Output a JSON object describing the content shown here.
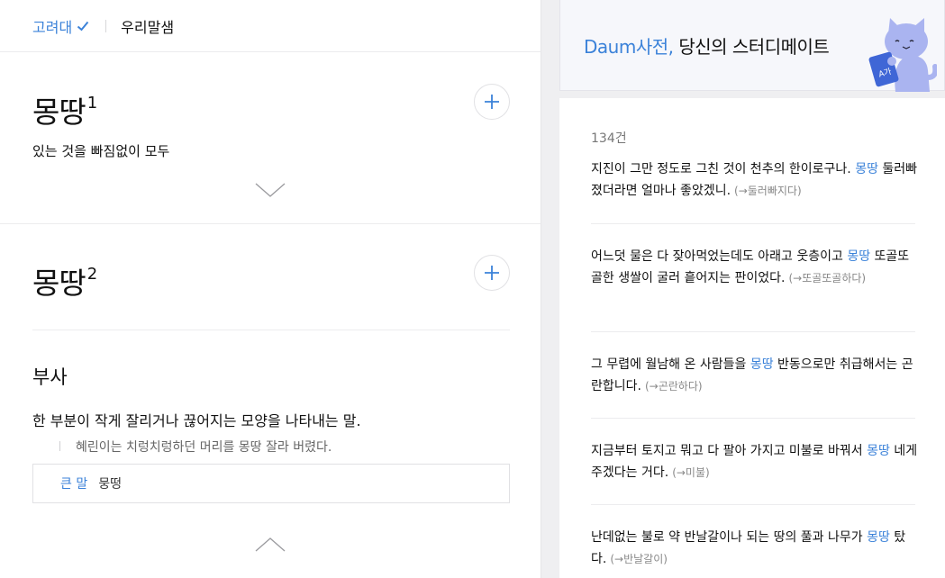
{
  "tabs": {
    "active": "고려대",
    "second": "우리말샘"
  },
  "entries": [
    {
      "word": "몽땅",
      "sup": "1",
      "meaning": "있는 것을 빠짐없이 모두"
    },
    {
      "word": "몽땅",
      "sup": "2",
      "pos": "부사",
      "meaning": "한 부분이 작게 잘리거나 끊어지는 모양을 나타내는 말.",
      "example": "혜린이는 치렁치렁하던 머리를 몽땅 잘라 버렸다.",
      "related_label": "큰 말",
      "related_value": "뭉떵"
    }
  ],
  "ad": {
    "brand": "Daum사전,",
    "tagline": "당신의 스터디메이트"
  },
  "examples": {
    "count": "134건",
    "items": [
      {
        "pre": "지진이 그만 정도로 그친 것이 천추의 한이로구나. ",
        "hl": "몽땅",
        "post": " 둘러빠졌더라면 얼마나 좋았겠니.",
        "ref": "(→둘러빠지다)"
      },
      {
        "pre": "어느덧 물은 다 잦아먹었는데도 아래고 웃층이고 ",
        "hl": "몽땅",
        "post": " 또골또골한 생쌀이 굴러 흩어지는 판이었다.",
        "ref": "(→또골또골하다)"
      },
      {
        "pre": "그 무렵에 월남해 온 사람들을 ",
        "hl": "몽땅",
        "post": " 반동으로만 취급해서는 곤란합니다.",
        "ref": "(→곤란하다)"
      },
      {
        "pre": "지금부터 토지고 뭐고 다 팔아 가지고 미불로 바꿔서 ",
        "hl": "몽땅",
        "post": " 네게 주겠다는 거다.",
        "ref": "(→미불)"
      },
      {
        "pre": "난데없는 불로 약 반날갈이나 되는 땅의 풀과 나무가 ",
        "hl": "몽땅",
        "post": " 탔다.",
        "ref": "(→반날갈이)"
      }
    ]
  },
  "colors": {
    "accent": "#3b82d9",
    "background": "#efeff1"
  },
  "icons": [
    "check-icon",
    "plus-icon",
    "chevron-down-icon",
    "chevron-up-icon",
    "cat-mascot"
  ]
}
